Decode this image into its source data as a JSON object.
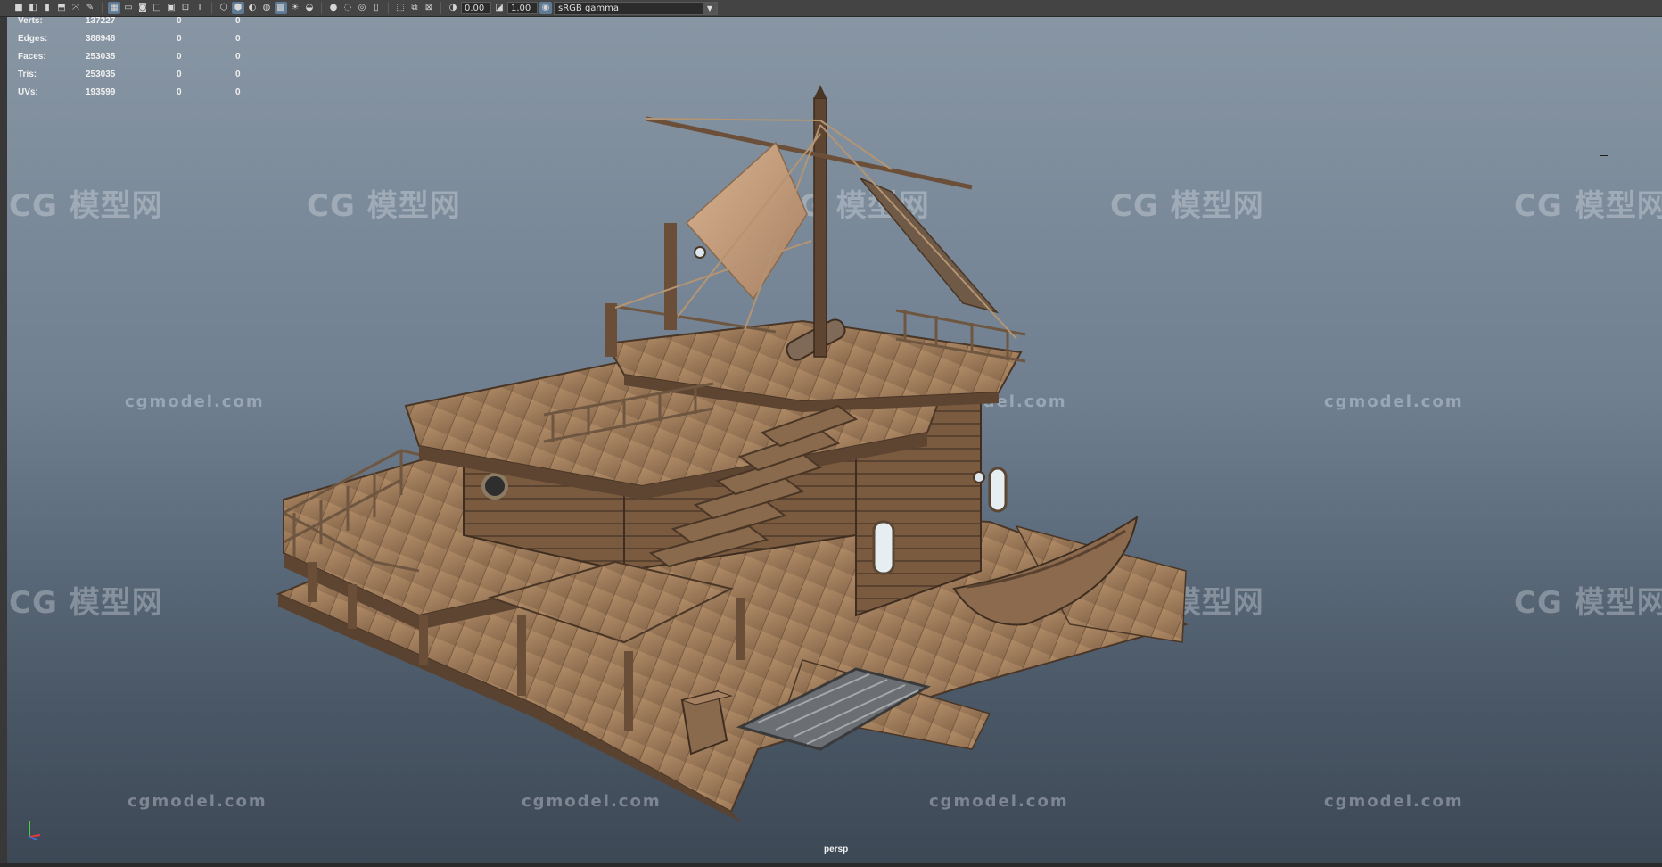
{
  "toolbar": {
    "exposure_value": "0.00",
    "gamma_value": "1.00",
    "color_space": "sRGB gamma"
  },
  "hud": {
    "rows": [
      {
        "label": "Verts:",
        "v1": "137227",
        "v2": "0",
        "v3": "0"
      },
      {
        "label": "Edges:",
        "v1": "388948",
        "v2": "0",
        "v3": "0"
      },
      {
        "label": "Faces:",
        "v1": "253035",
        "v2": "0",
        "v3": "0"
      },
      {
        "label": "Tris:",
        "v1": "253035",
        "v2": "0",
        "v3": "0"
      },
      {
        "label": "UVs:",
        "v1": "193599",
        "v2": "0",
        "v3": "0"
      }
    ]
  },
  "camera_label": "persp",
  "watermarks": {
    "cn": "模型网",
    "logo": "CG",
    "url": "cgmodel.com"
  },
  "colors": {
    "toolbar_bg": "#444444",
    "viewport_top": "#8896a4",
    "viewport_bottom": "#3d4855",
    "wood_light": "#a27f5c",
    "wood_dark": "#5a4230",
    "sail": "#c9a27d"
  }
}
